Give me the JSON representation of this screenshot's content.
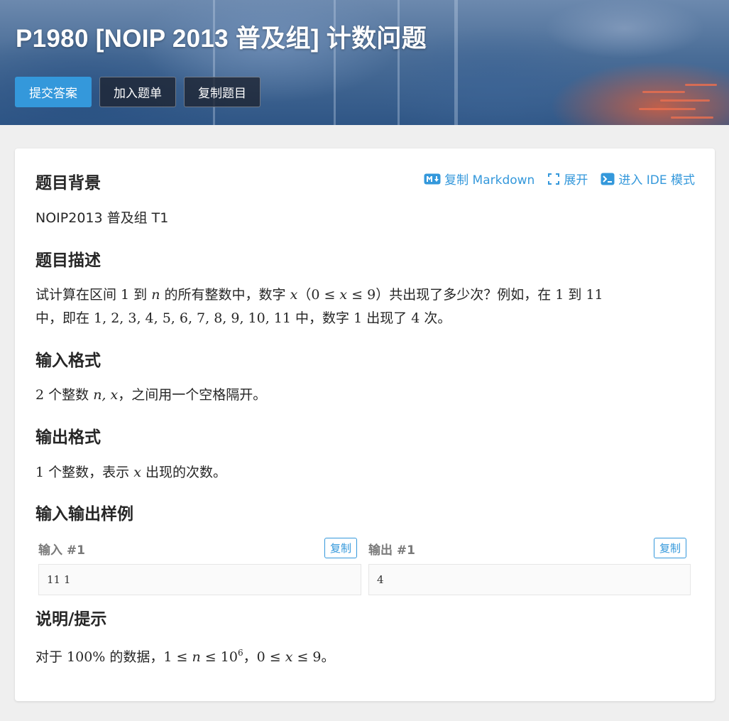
{
  "header": {
    "title": "P1980 [NOIP 2013 普及组] 计数问题",
    "actions": {
      "submit": "提交答案",
      "add_to_list": "加入题单",
      "copy_problem": "复制题目"
    }
  },
  "tools": {
    "copy_markdown": "复制 Markdown",
    "expand": "展开",
    "ide_mode": "进入 IDE 模式"
  },
  "sections": {
    "background": {
      "heading": "题目背景",
      "text": "NOIP2013 普及组 T1"
    },
    "description": {
      "heading": "题目描述",
      "l1_a": "试计算在区间 ",
      "l1_n1": "1",
      "l1_b": " 到 ",
      "l1_n": "n",
      "l1_c": " 的所有整数中，数字 ",
      "l1_x": "x",
      "l1_d": "（",
      "l1_r": "0 ≤ ",
      "l1_x2": "x",
      "l1_r2": " ≤ 9",
      "l1_e": "）共出现了多少次？例如，在 ",
      "l1_n2": "1",
      "l1_f": " 到 ",
      "l1_n3": "11",
      "l2_a": "中，即在 ",
      "l2_seq": "1, 2, 3, 4, 5, 6, 7, 8, 9, 10, 11",
      "l2_b": " 中，数字 ",
      "l2_n1": "1",
      "l2_c": " 出现了 ",
      "l2_n2": "4",
      "l2_d": " 次。"
    },
    "input_format": {
      "heading": "输入格式",
      "n2": "2",
      "a": " 个整数 ",
      "vars": "n, x",
      "b": "，之间用一个空格隔开。"
    },
    "output_format": {
      "heading": "输出格式",
      "n1": "1",
      "a": " 个整数，表示 ",
      "x": "x",
      "b": " 出现的次数。"
    },
    "samples": {
      "heading": "输入输出样例",
      "input_label": "输入 #1",
      "output_label": "输出 #1",
      "copy_label": "复制",
      "input_value": "11 1",
      "output_value": "4"
    },
    "hint": {
      "heading": "说明/提示",
      "a": "对于 ",
      "pct": "100%",
      "b": " 的数据，",
      "r1": "1 ≤ ",
      "n": "n",
      "r2": " ≤ 10",
      "exp": "6",
      "c": "，",
      "r3": "0 ≤ ",
      "x": "x",
      "r4": " ≤ 9",
      "d": "。"
    }
  },
  "colors": {
    "accent": "#3498db",
    "page_bg": "#efefef",
    "text": "#262626"
  },
  "icons": {
    "markdown": "markdown-icon",
    "expand": "expand-icon",
    "ide": "terminal-icon"
  }
}
